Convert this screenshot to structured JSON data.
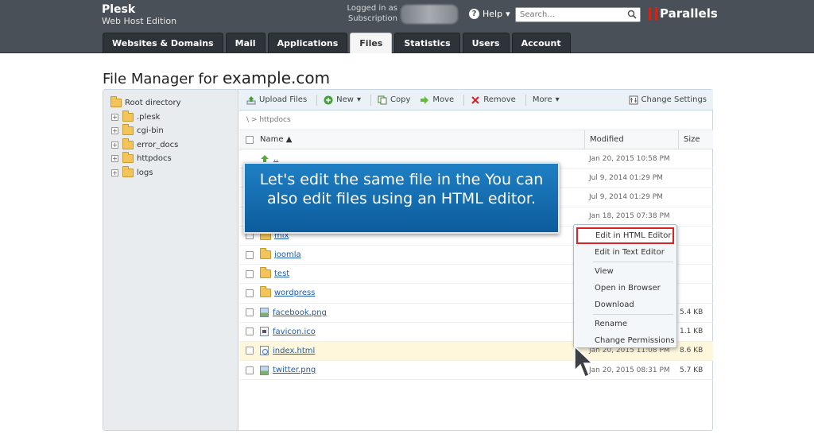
{
  "header": {
    "brand_name": "Plesk",
    "brand_edition": "Web Host Edition",
    "logged_in_label": "Logged in as",
    "subscription_label": "Subscription",
    "help_label": "Help",
    "search_placeholder": "Search...",
    "logo_text": "Parallels"
  },
  "tabs": [
    {
      "label": "Websites & Domains"
    },
    {
      "label": "Mail"
    },
    {
      "label": "Applications"
    },
    {
      "label": "Files",
      "active": true
    },
    {
      "label": "Statistics"
    },
    {
      "label": "Users"
    },
    {
      "label": "Account"
    }
  ],
  "page": {
    "title_prefix": "File Manager for",
    "domain": "example.com"
  },
  "tree": {
    "root": "Root directory",
    "children": [
      ".plesk",
      "cgi-bin",
      "error_docs",
      "httpdocs",
      "logs"
    ]
  },
  "toolbar": {
    "upload": "Upload Files",
    "new": "New",
    "copy": "Copy",
    "move": "Move",
    "remove": "Remove",
    "more": "More",
    "settings": "Change Settings"
  },
  "breadcrumb": {
    "path": "httpdocs"
  },
  "grid": {
    "col_name": "Name",
    "col_modified": "Modified",
    "col_size": "Size",
    "rows": [
      {
        "name": "..",
        "modified": "Jan 20, 2015 10:58 PM",
        "size": ""
      },
      {
        "name": "",
        "modified": "Jul 9, 2014 01:29 PM",
        "size": ""
      },
      {
        "name": "",
        "modified": "Jul 9, 2014 01:29 PM",
        "size": ""
      },
      {
        "name": "",
        "modified": "Jan 18, 2015 07:38 PM",
        "size": ""
      },
      {
        "name": "mix",
        "modified": "",
        "size": ""
      },
      {
        "name": "joomla",
        "modified": "",
        "size": ""
      },
      {
        "name": "test",
        "modified": "",
        "size": ""
      },
      {
        "name": "wordpress",
        "modified": "",
        "size": ""
      },
      {
        "name": "facebook.png",
        "modified": "",
        "size": "5.4 KB"
      },
      {
        "name": "favicon.ico",
        "modified": "",
        "size": "1.1 KB"
      },
      {
        "name": "index.html",
        "modified": "Jan 20, 2015 11:08 PM",
        "size": "8.6 KB"
      },
      {
        "name": "twitter.png",
        "modified": "Jan 20, 2015 08:31 PM",
        "size": "5.7 KB"
      }
    ]
  },
  "callout": {
    "text": "Let's edit the same file in the You can also edit files using an HTML editor."
  },
  "context_menu": {
    "items": [
      "Edit in HTML Editor",
      "Edit in Text Editor",
      "View",
      "Open in Browser",
      "Download",
      "Rename",
      "Change Permissions"
    ]
  }
}
